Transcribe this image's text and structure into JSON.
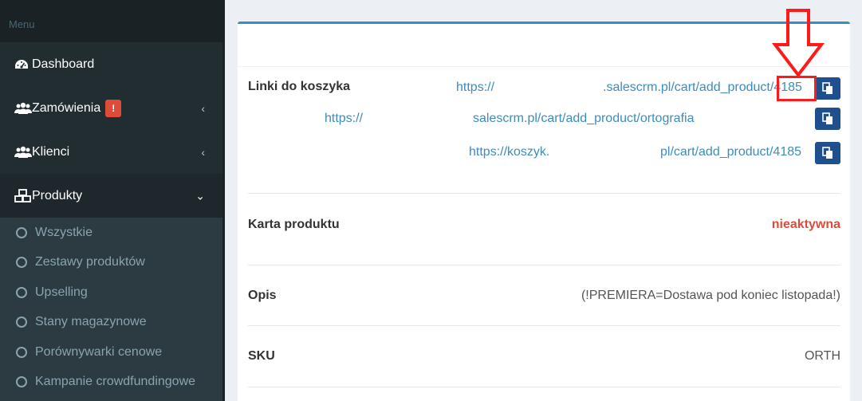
{
  "sidebar": {
    "header": "Menu",
    "items": [
      {
        "label": "Dashboard",
        "icon": "dashboard-icon"
      },
      {
        "label": "Zamówienia",
        "icon": "users-icon",
        "badge": "!"
      },
      {
        "label": "Klienci",
        "icon": "users-icon"
      },
      {
        "label": "Produkty",
        "icon": "cubes-icon"
      }
    ],
    "subitems": [
      "Wszystkie",
      "Zestawy produktów",
      "Upselling",
      "Stany magazynowe",
      "Porównywarki cenowe",
      "Kampanie crowdfundingowe"
    ]
  },
  "details": {
    "links_label": "Linki do koszyka",
    "links": [
      {
        "prefix": "https://",
        "suffix": ".salescrm.pl/cart/add_product/4185"
      },
      {
        "prefix": "https://",
        "suffix": "salescrm.pl/cart/add_product/ortografia"
      },
      {
        "prefix": "https://koszyk.",
        "suffix": "pl/cart/add_product/4185"
      }
    ],
    "card_label": "Karta produktu",
    "card_value": "nieaktywna",
    "desc_label": "Opis",
    "desc_value": "(!PREMIERA=Dostawa pod koniec listopada!)",
    "sku_label": "SKU",
    "sku_value": "ORTH"
  },
  "colors": {
    "sidebar_bg": "#222d32",
    "accent": "#3c8dbc",
    "danger": "#dd4b39",
    "annotation": "#ff1a1a"
  }
}
